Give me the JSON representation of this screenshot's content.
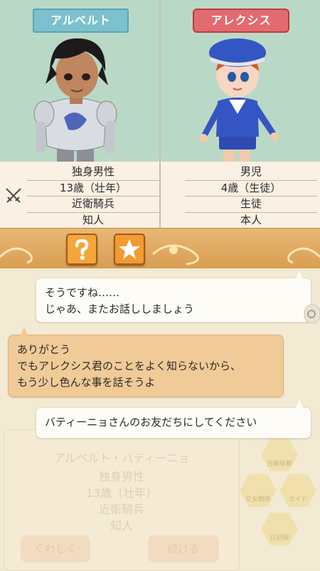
{
  "left_character": {
    "name": "アルベルト",
    "info": [
      "独身男性",
      "13歳（壮年）",
      "近衛騎兵",
      "知人"
    ]
  },
  "right_character": {
    "name": "アレクシス",
    "info": [
      "男児",
      "4歳（生徒）",
      "生徒",
      "本人"
    ]
  },
  "toolbar": {
    "help_icon": "question-mark-icon",
    "favorite_icon": "star-icon"
  },
  "messages": [
    {
      "speaker": "right",
      "lines": [
        "そうですね……",
        "じゃあ、またお話ししましょう"
      ]
    },
    {
      "speaker": "left",
      "lines": [
        "ありがとう",
        "でもアレクシス君のことをよく知らないから、",
        "もう少し色んな事を話そうよ"
      ]
    },
    {
      "speaker": "right",
      "lines": [
        "バティーニョさんのお友だちにしてください"
      ]
    }
  ],
  "background_card": {
    "name": "アルベルト・バティーニョ",
    "info": [
      "独身男性",
      "13歳（壮年）",
      "近衛騎兵",
      "知人"
    ],
    "details_button": "くわしく",
    "continue_button": "続ける"
  },
  "side_menu": [
    {
      "label": "自動移動"
    },
    {
      "label": "交友関係"
    },
    {
      "label": "ガイド"
    },
    {
      "label": "日記帳"
    }
  ],
  "colors": {
    "name_tag_left": "#7cc1cd",
    "name_tag_right": "#e26b6e",
    "ornament_bar": "#e0aa60",
    "bubble_reply": "#f0ca97",
    "portrait_bg": "#b9d9c6"
  }
}
